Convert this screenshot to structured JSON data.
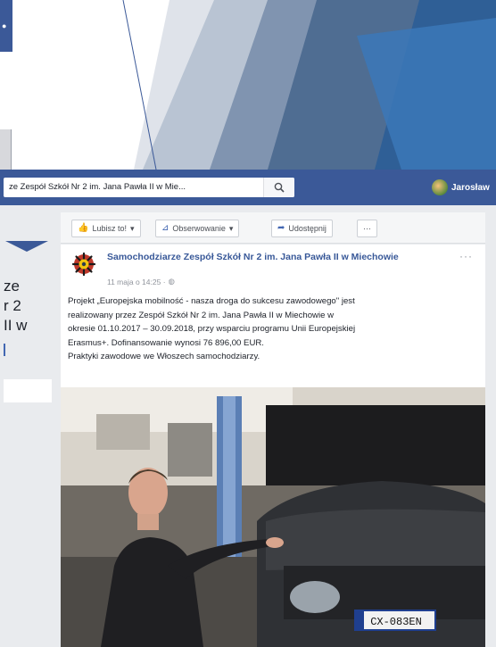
{
  "window": {
    "search_query": "ze  Zespół Szkół Nr 2 im. Jana Pawła II w Mie...",
    "profile_name": "Jarosław"
  },
  "sidebar": {
    "page_name_fragment": "ze\nr 2\nII w"
  },
  "actions": {
    "like": "Lubisz to!",
    "follow": "Obserwowanie",
    "share": "Udostępnij",
    "more": "···"
  },
  "post": {
    "page_name": "Samochodziarze Zespół Szkół Nr 2 im. Jana Pawła II w Miechowie",
    "time": "11 maja o 14:25 ·",
    "more_icon": "···",
    "body_lines": [
      "Projekt „Europejska mobilność - nasza droga do sukcesu zawodowego\" jest",
      "realizowany przez Zespół Szkół Nr 2 im. Jana Pawła II w Miechowie w",
      "okresie 01.10.2017 – 30.09.2018, przy wsparciu programu Unii Europejskiej",
      "Erasmus+. Dofinansowanie wynosi 76 896,00 EUR.",
      "Praktyki zawodowe we Włoszech samochodziarzy."
    ],
    "plate": "CX-083EN"
  },
  "colors": {
    "facebook_blue": "#3b5998",
    "link_blue": "#385898",
    "slide_blue": "#3b78b8"
  },
  "icons": {
    "search": "search-icon",
    "like": "thumbs-up-icon",
    "follow": "rss-icon",
    "share": "share-arrow-icon",
    "globe": "globe-icon"
  }
}
